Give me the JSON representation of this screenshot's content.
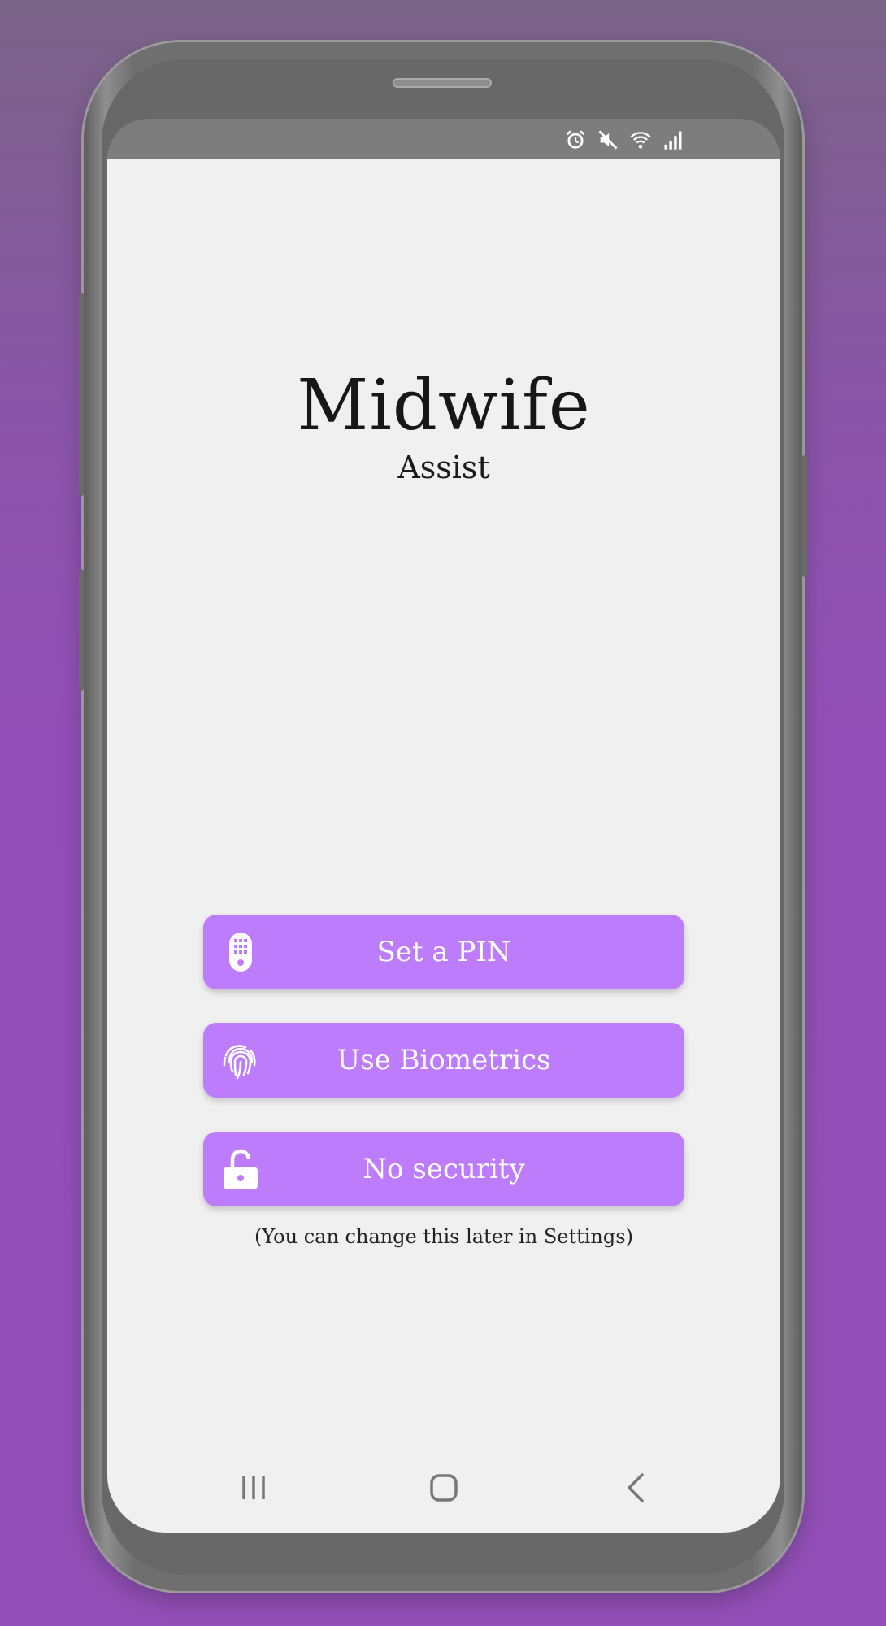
{
  "app": {
    "title": "Midwife",
    "subtitle": "Assist"
  },
  "status_bar": {
    "icons": [
      "alarm-icon",
      "mute-icon",
      "wifi-icon",
      "signal-icon"
    ]
  },
  "security_options": [
    {
      "label": "Set a PIN",
      "icon": "keypad-icon"
    },
    {
      "label": "Use Biometrics",
      "icon": "fingerprint-icon"
    },
    {
      "label": "No security",
      "icon": "unlocked-padlock-icon"
    }
  ],
  "hint": "(You can change this later in Settings)",
  "nav_bar": {
    "icons": [
      "recents-icon",
      "home-icon",
      "back-icon"
    ]
  },
  "colors": {
    "accent": "#bd7cfc",
    "background": "#9350b8",
    "screen": "#f0f0f0"
  }
}
